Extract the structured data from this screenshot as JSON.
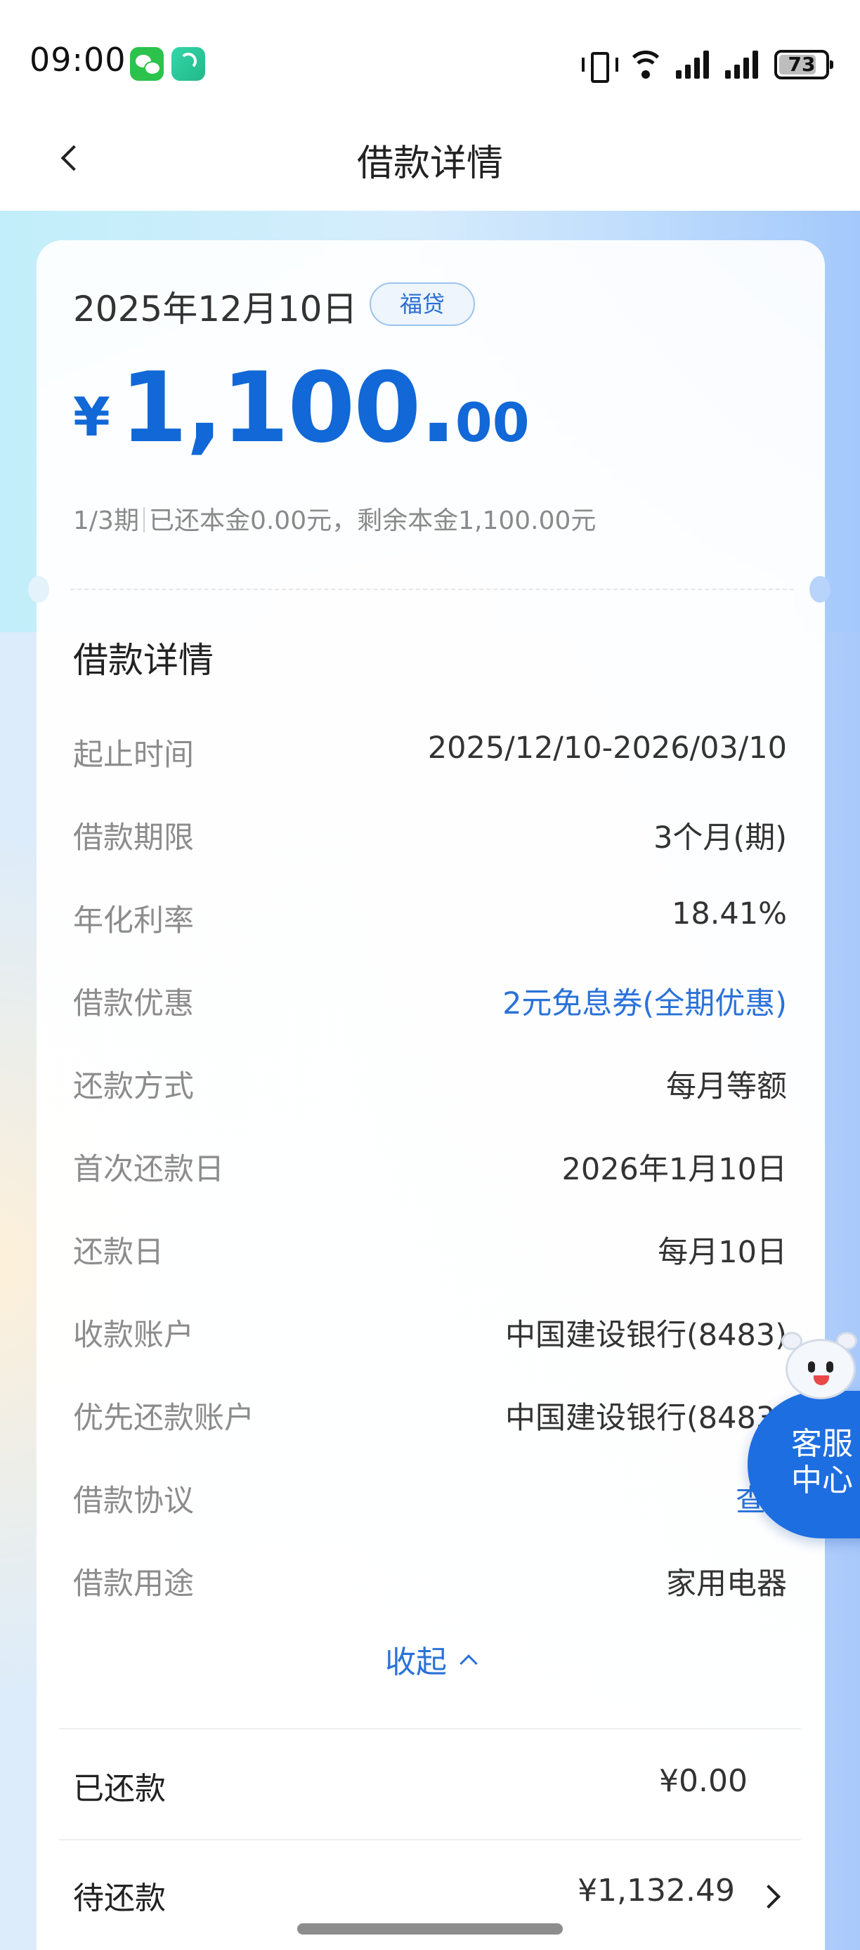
{
  "status_bar": {
    "time": "09:00",
    "battery": "73"
  },
  "header": {
    "title": "借款详情"
  },
  "loan": {
    "date": "2025年12月10日",
    "badge": "福贷",
    "currency": "¥",
    "amount_int": "1,100.",
    "amount_dec": "00",
    "term_progress": "1/3期",
    "repaid_summary": "已还本金0.00元，剩余本金1,100.00元"
  },
  "details": {
    "title": "借款详情",
    "rows": [
      {
        "label": "起止时间",
        "value": "2025/12/10-2026/03/10"
      },
      {
        "label": "借款期限",
        "value": "3个月(期)"
      },
      {
        "label": "年化利率",
        "value": "18.41%"
      },
      {
        "label": "借款优惠",
        "value": "2元免息券(全期优惠)"
      },
      {
        "label": "还款方式",
        "value": "每月等额"
      },
      {
        "label": "首次还款日",
        "value": "2026年1月10日"
      },
      {
        "label": "还款日",
        "value": "每月10日"
      },
      {
        "label": "收款账户",
        "value": "中国建设银行(8483)"
      },
      {
        "label": "优先还款账户",
        "value": "中国建设银行(8483)"
      },
      {
        "label": "借款协议",
        "value": "查"
      },
      {
        "label": "借款用途",
        "value": "家用电器"
      }
    ],
    "collapse_label": "收起"
  },
  "summary": {
    "repaid_label": "已还款",
    "repaid_value": "¥0.00",
    "pending_label": "待还款",
    "pending_value": "¥1,132.49"
  },
  "customer_service": {
    "label": "客服中心"
  },
  "colors": {
    "brand_blue": "#1168d6",
    "link_blue": "#2a72d9"
  }
}
